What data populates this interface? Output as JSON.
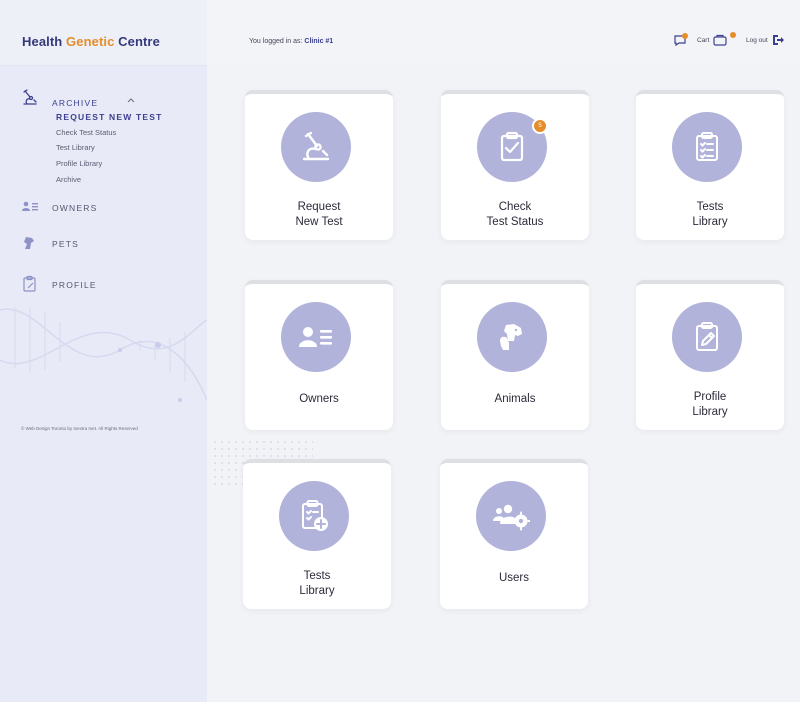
{
  "header": {
    "logo_part1": "Health ",
    "logo_part2": "Genetic",
    "logo_part3": " Centre",
    "login_prefix": "You logged in as: ",
    "login_user": "Clinic #1",
    "cart_label": "Cart",
    "logout_label": "Log out"
  },
  "sidebar": {
    "archive_label": "ARCHIVE",
    "request_new_test": "REQUEST NEW TEST",
    "sub_items": [
      "Check Test Status",
      "Test Library",
      "Profile Library",
      "Archive"
    ],
    "owners_label": "OWNERS",
    "pets_label": "PETS",
    "profile_label": "PROFILE",
    "copyright": "© Web Design Toronto by Inextra Inet. All Rights Reserved"
  },
  "tiles": [
    {
      "label": "Request\nNew Test",
      "icon": "microscope-icon"
    },
    {
      "label": "Check\nTest Status",
      "icon": "clipboard-check-icon",
      "badge": "5"
    },
    {
      "label": "Tests\nLibrary",
      "icon": "clipboard-list-icon"
    },
    {
      "label": "Owners",
      "icon": "owners-icon"
    },
    {
      "label": "Animals",
      "icon": "animals-icon"
    },
    {
      "label": "Profile\nLibrary",
      "icon": "clipboard-edit-icon"
    },
    {
      "label": "Tests\nLibrary",
      "icon": "clipboard-add-icon"
    },
    {
      "label": "Users",
      "icon": "users-gear-icon"
    }
  ],
  "colors": {
    "brand": "#35397c",
    "accent": "#e58d2a",
    "icon_circle": "#b1b3da",
    "sidebar_bg": "#e8eaf7"
  }
}
